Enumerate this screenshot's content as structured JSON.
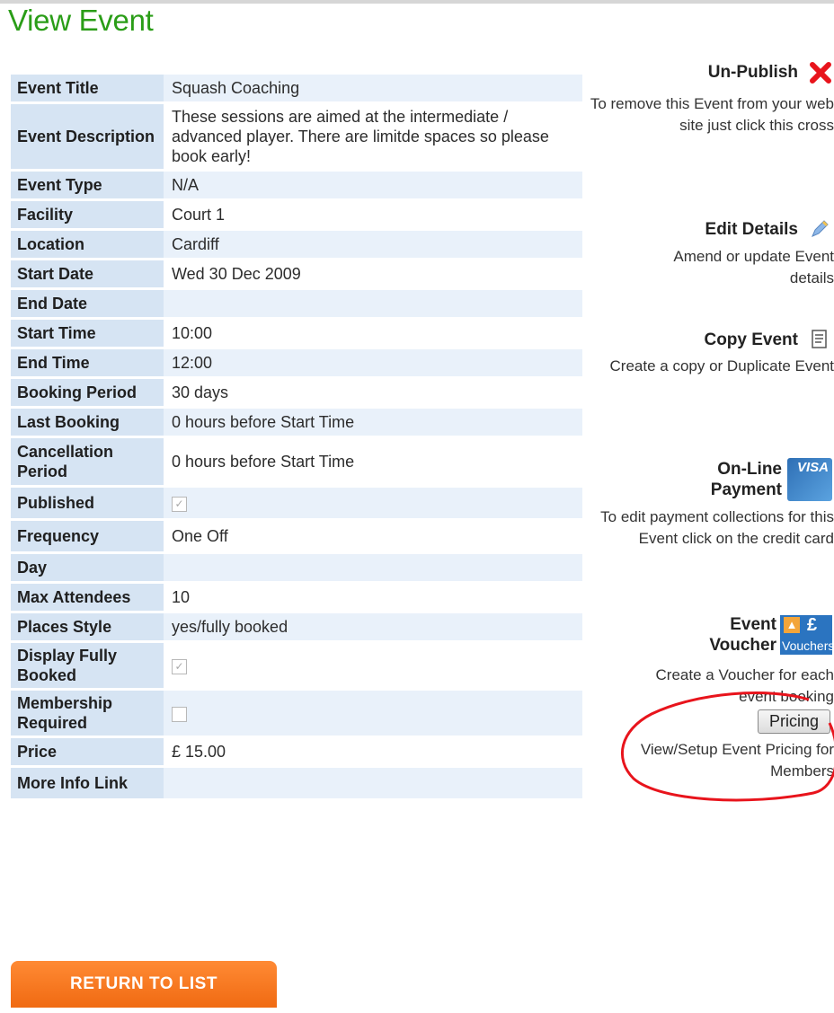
{
  "page": {
    "title": "View Event"
  },
  "details": [
    {
      "label": "Event Title",
      "value": "Squash Coaching"
    },
    {
      "label": "Event Description",
      "value": "These sessions are aimed at the intermediate / advanced player. There are limitde spaces so please book early!"
    },
    {
      "label": "Event Type",
      "value": "N/A"
    },
    {
      "label": "Facility",
      "value": "Court 1"
    },
    {
      "label": "Location",
      "value": "Cardiff"
    },
    {
      "label": "Start Date",
      "value": "Wed 30 Dec 2009"
    },
    {
      "label": "End Date",
      "value": ""
    },
    {
      "label": "Start Time",
      "value": "10:00"
    },
    {
      "label": "End Time",
      "value": "12:00"
    },
    {
      "label": "Booking Period",
      "value": "30 days"
    },
    {
      "label": "Last Booking",
      "value": "0 hours before Start Time"
    },
    {
      "label": "Cancellation Period",
      "value": "0 hours before Start Time"
    },
    {
      "label": "Published",
      "checkbox": true,
      "checked": true
    },
    {
      "label": "Frequency",
      "value": "One Off"
    },
    {
      "label": "Day",
      "value": ""
    },
    {
      "label": "Max Attendees",
      "value": "10"
    },
    {
      "label": "Places Style",
      "value": "yes/fully booked"
    },
    {
      "label": "Display Fully Booked",
      "checkbox": true,
      "checked": true
    },
    {
      "label": "Membership Required",
      "checkbox": true,
      "checked": false
    },
    {
      "label": "Price",
      "value": "£ 15.00"
    },
    {
      "label": "More Info Link",
      "value": ""
    }
  ],
  "actions": {
    "unpublish": {
      "title": "Un-Publish",
      "desc": "To remove this Event from your web site just click this cross",
      "icon": "red-cross-icon"
    },
    "edit": {
      "title": "Edit Details",
      "desc": "Amend or update Event details",
      "icon": "pencil-icon"
    },
    "copy": {
      "title": "Copy Event",
      "desc": "Create a copy or Duplicate Event",
      "icon": "document-icon"
    },
    "payment": {
      "title": "On-Line Payment",
      "desc": "To edit payment collections for this Event click on the credit card",
      "icon": "credit-card-icon",
      "card_text": "VISA"
    },
    "voucher": {
      "title": "Event Voucher",
      "desc": "Create a Voucher for each event booking",
      "icon": "voucher-icon",
      "badge_symbol": "£",
      "badge_text": "Vouchers"
    },
    "pricing": {
      "button": "Pricing",
      "desc": "View/Setup Event Pricing for Members"
    }
  },
  "return_button": "RETURN TO LIST",
  "colors": {
    "title": "#2a9d17",
    "label_bg": "#d6e4f3",
    "value_alt_bg": "#e9f1fa",
    "button": "#f06a12",
    "highlight": "#e8141c"
  }
}
